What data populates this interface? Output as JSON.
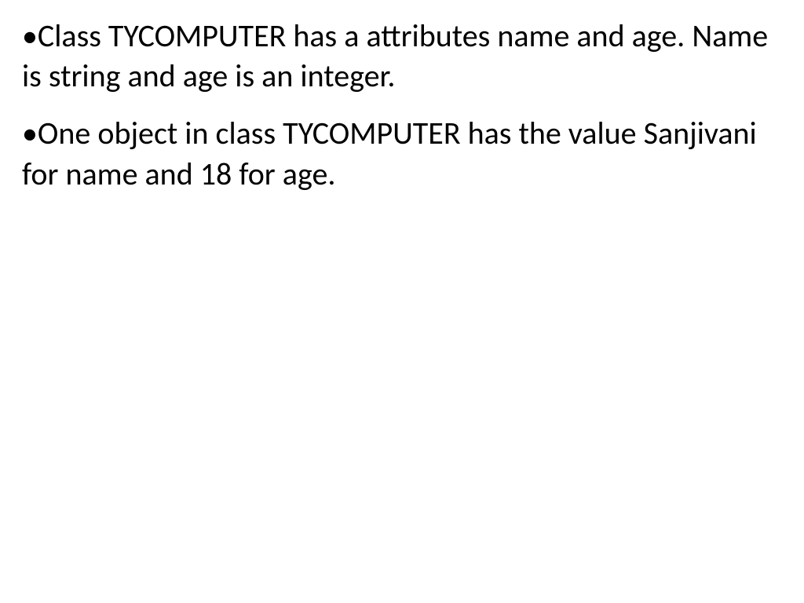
{
  "slide": {
    "bullets": [
      {
        "marker": "•",
        "text": "Class TYCOMPUTER has a attributes name and age. Name is string and age is  an integer."
      },
      {
        "marker": "•",
        "text": "One object in class TYCOMPUTER has the value Sanjivani for name and 18 for age."
      }
    ]
  }
}
